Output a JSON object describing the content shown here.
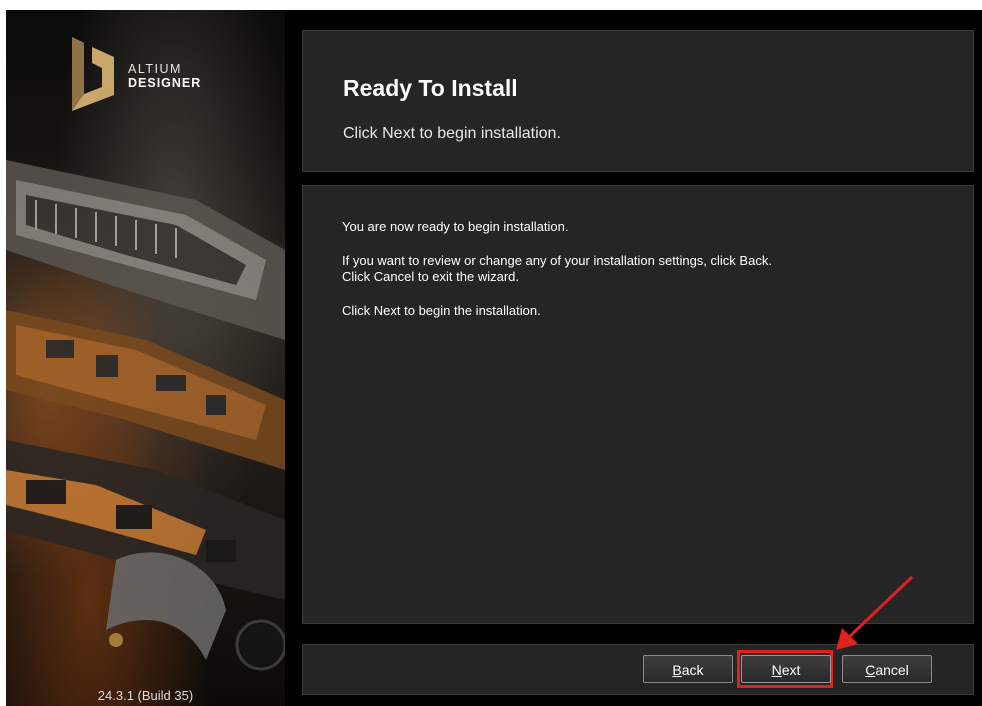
{
  "brand": {
    "line1": "ALTIUM",
    "line2": "DESIGNER",
    "accent_color": "#c9a66b"
  },
  "build_label": "24.3.1 (Build 35)",
  "header": {
    "title": "Ready To Install",
    "subtitle": "Click Next to begin installation."
  },
  "content": {
    "para1": "You are now ready to begin installation.",
    "para2_line1": "If you want to review or change any of your installation settings, click Back.",
    "para2_line2": "Click Cancel to exit the wizard.",
    "para3": "Click Next to begin the installation."
  },
  "buttons": {
    "back": {
      "mnemonic": "B",
      "rest": "ack"
    },
    "next": {
      "mnemonic": "N",
      "rest": "ext"
    },
    "cancel": {
      "mnemonic": "C",
      "rest": "ancel"
    }
  },
  "annotation": {
    "highlight_color": "#e32020"
  }
}
